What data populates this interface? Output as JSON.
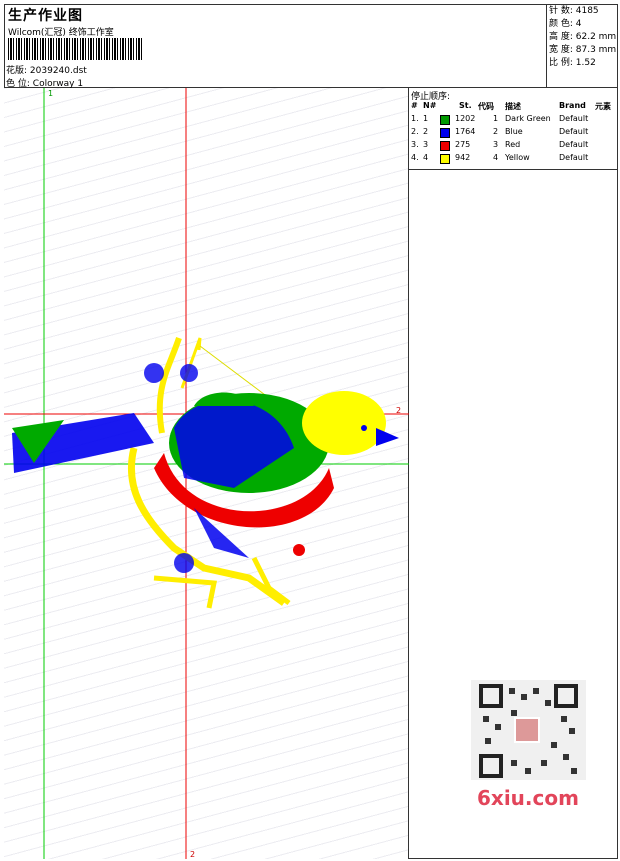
{
  "header": {
    "title": "生产作业图",
    "studio": "Wilcom(汇冠) 终饰工作室",
    "pattern_label": "花版:",
    "pattern_value": "2039240.dst",
    "colorway_label": "色 位:",
    "colorway_value": "Colorway 1"
  },
  "info": {
    "stitches": "针 数: 4185",
    "colors": "颜 色: 4",
    "height": "高 度: 62.2 mm",
    "width": "宽 度: 87.3 mm",
    "ratio": "比 例: 1.52"
  },
  "stop_sequence": {
    "caption": "停止顺序:",
    "headers": [
      "#",
      "N#",
      "St.",
      "代码",
      "描述",
      "Brand",
      "元素"
    ],
    "rows": [
      {
        "num": "1.",
        "n": "1",
        "color": "#009900",
        "st": "1202",
        "code": "1",
        "desc": "Dark Green",
        "brand": "Default"
      },
      {
        "num": "2.",
        "n": "2",
        "color": "#0000ee",
        "st": "1764",
        "code": "2",
        "desc": "Blue",
        "brand": "Default"
      },
      {
        "num": "3.",
        "n": "3",
        "color": "#ee0000",
        "st": "275",
        "code": "3",
        "desc": "Red",
        "brand": "Default"
      },
      {
        "num": "4.",
        "n": "4",
        "color": "#ffff00",
        "st": "942",
        "code": "4",
        "desc": "Yellow",
        "brand": "Default"
      }
    ]
  },
  "guides": {
    "green_vertical_label": "1",
    "red_horizontal_label": "2",
    "red_vertical_label": "2"
  },
  "watermark": "6xiu.com",
  "colors": {
    "green": "#00aa00",
    "blue": "#0000ee",
    "red": "#ee0000",
    "yellow": "#ffff00"
  }
}
